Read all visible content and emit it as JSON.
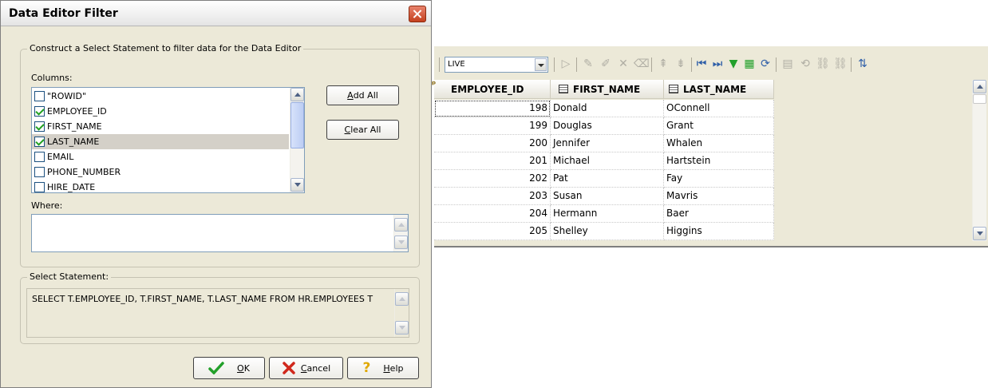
{
  "dialog": {
    "title": "Data Editor Filter",
    "group_label": "Construct a Select Statement to filter data for the Data Editor",
    "columns_label": "Columns:",
    "columns": [
      {
        "name": "\"ROWID\"",
        "checked": false
      },
      {
        "name": "EMPLOYEE_ID",
        "checked": true
      },
      {
        "name": "FIRST_NAME",
        "checked": true
      },
      {
        "name": "LAST_NAME",
        "checked": true,
        "selected": true
      },
      {
        "name": "EMAIL",
        "checked": false
      },
      {
        "name": "PHONE_NUMBER",
        "checked": false
      },
      {
        "name": "HIRE_DATE",
        "checked": false
      }
    ],
    "add_all_label": "dd All",
    "add_all_mnemonic": "A",
    "clear_all_label": "lear All",
    "clear_all_mnemonic": "C",
    "where_label": "Where:",
    "where_value": "",
    "select_label": "Select Statement:",
    "select_value": "SELECT T.EMPLOYEE_ID, T.FIRST_NAME, T.LAST_NAME FROM HR.EMPLOYEES T",
    "ok_label": "K",
    "ok_mnemonic": "O",
    "cancel_label": "ancel",
    "cancel_mnemonic": "C",
    "help_label": "elp",
    "help_mnemonic": "H"
  },
  "editor": {
    "connection": "LIVE",
    "columns": [
      "EMPLOYEE_ID",
      "FIRST_NAME",
      "LAST_NAME"
    ],
    "rows": [
      [
        "198",
        "Donald",
        "OConnell"
      ],
      [
        "199",
        "Douglas",
        "Grant"
      ],
      [
        "200",
        "Jennifer",
        "Whalen"
      ],
      [
        "201",
        "Michael",
        "Hartstein"
      ],
      [
        "202",
        "Pat",
        "Fay"
      ],
      [
        "203",
        "Susan",
        "Mavris"
      ],
      [
        "204",
        "Hermann",
        "Baer"
      ],
      [
        "205",
        "Shelley",
        "Higgins"
      ]
    ]
  },
  "colors": {
    "dialog_bg": "#ece9d8",
    "close_button": "#c4401f",
    "check_mark": "#21a121",
    "ok_icon": "#22a02a",
    "cancel_icon": "#d0281c",
    "help_icon": "#e0a800"
  }
}
